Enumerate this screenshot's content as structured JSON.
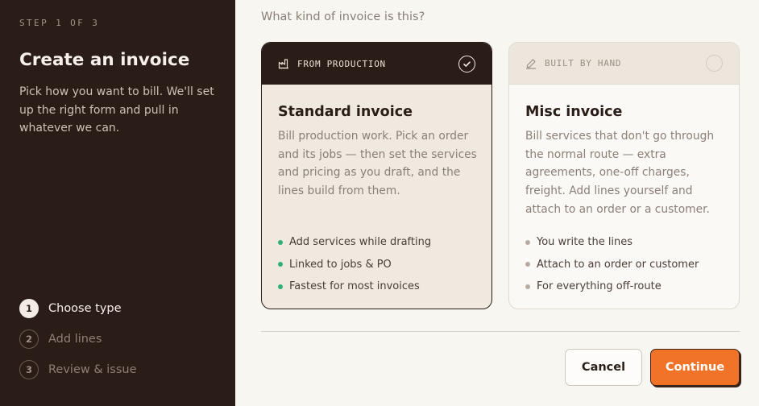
{
  "sidebar": {
    "step_indicator": "STEP 1 OF 3",
    "title": "Create an invoice",
    "description": "Pick how you want to bill. We'll set up the right form and pull in whatever we can.",
    "steps": [
      {
        "num": "1",
        "label": "Choose type",
        "active": true
      },
      {
        "num": "2",
        "label": "Add lines",
        "active": false
      },
      {
        "num": "3",
        "label": "Review & issue",
        "active": false
      }
    ]
  },
  "main": {
    "question": "What kind of invoice is this?",
    "cards": [
      {
        "tag": "FROM PRODUCTION",
        "icon": "factory-icon",
        "title": "Standard invoice",
        "description": "Bill production work. Pick an order and its jobs — then set the services and pricing as you draft, and the lines build from them.",
        "bullets": [
          "Add services while drafting",
          "Linked to jobs & PO",
          "Fastest for most invoices"
        ],
        "selected": true
      },
      {
        "tag": "BUILT BY HAND",
        "icon": "pencil-icon",
        "title": "Misc invoice",
        "description": "Bill services that don't go through the normal route — extra agreements, one-off charges, freight. Add lines yourself and attach to an order or a customer.",
        "bullets": [
          "You write the lines",
          "Attach to an order or customer",
          "For everything off-route"
        ],
        "selected": false
      }
    ],
    "actions": {
      "cancel_label": "Cancel",
      "continue_label": "Continue"
    }
  },
  "colors": {
    "sidebar_bg": "#2a1d18",
    "accent": "#f07328",
    "bullet_active": "#2fae79",
    "page_bg": "#f8f6f1"
  }
}
